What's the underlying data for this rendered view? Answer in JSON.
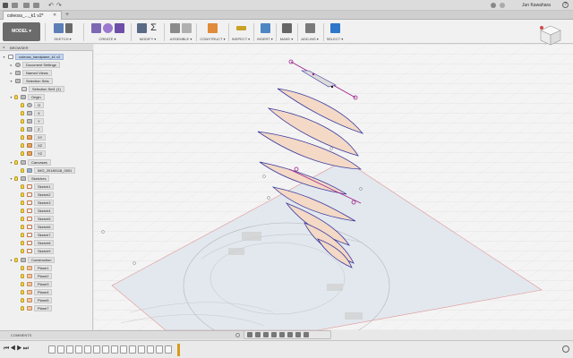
{
  "window": {
    "file_tab": "coleoss_..._k1 v2*",
    "user_name": "Jun Kawahara",
    "help_label": "?"
  },
  "toolbar": {
    "workspace": "MODEL ▾",
    "groups": [
      "SKETCH ▾",
      "CREATE ▾",
      "MODIFY ▾",
      "ASSEMBLE ▾",
      "CONSTRUCT ▾",
      "INSPECT ▾",
      "INSERT ▾",
      "MAKE ▾",
      "ADD-INS ▾",
      "SELECT ▾"
    ]
  },
  "browser": {
    "title": "BROWSER",
    "root": "coleoss_handplane_k1 v2",
    "items": [
      {
        "label": "Document Settings"
      },
      {
        "label": "Named Views"
      },
      {
        "label": "Selection Sets"
      },
      {
        "label": "Selection Set1 (1)"
      },
      {
        "label": "Origin"
      },
      {
        "label": "O"
      },
      {
        "label": "X"
      },
      {
        "label": "Y"
      },
      {
        "label": "Z"
      },
      {
        "label": "XY"
      },
      {
        "label": "XZ"
      },
      {
        "label": "YZ"
      },
      {
        "label": "Canvases"
      },
      {
        "label": "IMG_20180118_0001"
      },
      {
        "label": "Sketches"
      },
      {
        "label": "Sketch1"
      },
      {
        "label": "Sketch2"
      },
      {
        "label": "Sketch3"
      },
      {
        "label": "Sketch4"
      },
      {
        "label": "Sketch5"
      },
      {
        "label": "Sketch6"
      },
      {
        "label": "Sketch7"
      },
      {
        "label": "Sketch8"
      },
      {
        "label": "Sketch9"
      },
      {
        "label": "Construction"
      },
      {
        "label": "Plane1"
      },
      {
        "label": "Plane2"
      },
      {
        "label": "Plane3"
      },
      {
        "label": "Plane4"
      },
      {
        "label": "Plane5"
      },
      {
        "label": "Plane7"
      }
    ]
  },
  "comments": {
    "title": "COMMENTS"
  },
  "colors": {
    "accent": "#1f6fc4",
    "sketch_profile": "#f3d9c6",
    "sketch_line": "#3a3aa0",
    "selected_line": "#a0208a"
  }
}
